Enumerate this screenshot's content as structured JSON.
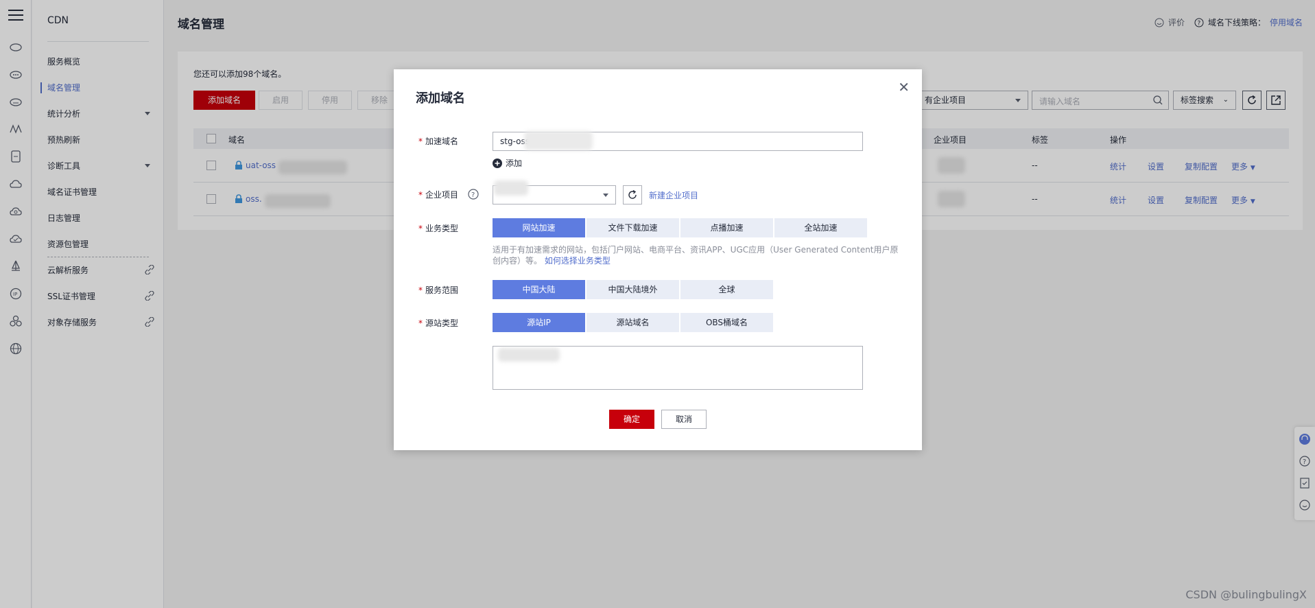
{
  "sidebar": {
    "title": "CDN",
    "items": [
      {
        "label": "服务概览"
      },
      {
        "label": "域名管理"
      },
      {
        "label": "统计分析"
      },
      {
        "label": "预热刷新"
      },
      {
        "label": "诊断工具"
      },
      {
        "label": "域名证书管理"
      },
      {
        "label": "日志管理"
      },
      {
        "label": "资源包管理"
      },
      {
        "label": "云解析服务"
      },
      {
        "label": "SSL证书管理"
      },
      {
        "label": "对象存储服务"
      }
    ]
  },
  "header": {
    "title": "域名管理",
    "feedback": "评价",
    "offline_policy_label": "域名下线策略：",
    "offline_policy_link": "停用域名"
  },
  "card": {
    "hint": "您还可以添加98个域名。",
    "buttons": {
      "add": "添加域名",
      "enable": "启用",
      "disable": "停用",
      "remove": "移除"
    },
    "project_select": "有企业项目",
    "search_placeholder": "请输入域名",
    "tag_search": "标签搜索",
    "columns": {
      "domain": "域名",
      "project": "企业项目",
      "tag": "标签",
      "actions": "操作"
    },
    "rows": [
      {
        "domain": "uat-oss",
        "tag": "--",
        "actions": [
          "统计",
          "设置",
          "复制配置",
          "更多"
        ]
      },
      {
        "domain": "oss.",
        "tag": "--",
        "actions": [
          "统计",
          "设置",
          "复制配置",
          "更多"
        ]
      }
    ]
  },
  "modal": {
    "title": "添加域名",
    "fields": {
      "domain_label": "加速域名",
      "domain_value": "stg-oss.",
      "add_label": "添加",
      "project_label": "企业项目",
      "new_project": "新建企业项目",
      "biz_label": "业务类型",
      "biz_options": [
        "网站加速",
        "文件下载加速",
        "点播加速",
        "全站加速"
      ],
      "biz_desc": "适用于有加速需求的网站，包括门户网站、电商平台、资讯APP、UGC应用（User Generated Content用户原创内容）等。",
      "biz_desc_link": "如何选择业务类型",
      "scope_label": "服务范围",
      "scope_options": [
        "中国大陆",
        "中国大陆境外",
        "全球"
      ],
      "origin_label": "源站类型",
      "origin_options": [
        "源站IP",
        "源站域名",
        "OBS桶域名"
      ]
    },
    "ok": "确定",
    "cancel": "取消"
  },
  "watermark": "CSDN @bulingbulingX",
  "colors": {
    "brand_red": "#c7000b",
    "link_blue": "#526ecc",
    "segment_active": "#5e7ce0"
  }
}
